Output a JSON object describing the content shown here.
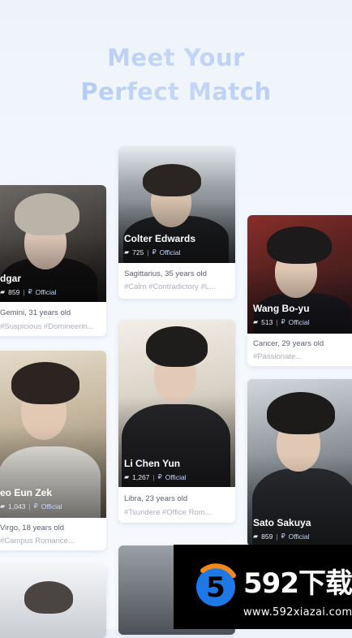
{
  "headline": {
    "line1": "Meet Your",
    "line2": "Perfect Match"
  },
  "characters": [
    {
      "name": "dgar",
      "chats": "859",
      "badge": "Official",
      "zodiac_age": "Gemini, 31 years old",
      "tags": "#Suspicious #Domineerin..."
    },
    {
      "name": "Colter Edwards",
      "chats": "725",
      "badge": "Official",
      "zodiac_age": "Sagittarius, 35 years old",
      "tags": "#Calm #Contradictory #L..."
    },
    {
      "name": "Wang Bo-yu",
      "chats": "513",
      "badge": "Official",
      "zodiac_age": "Cancer, 29 years old",
      "tags": "#Passionate..."
    },
    {
      "name": "eo Eun Zek",
      "chats": "1,043",
      "badge": "Official",
      "zodiac_age": "Virgo, 18 years old",
      "tags": "#Campus Romance..."
    },
    {
      "name": "Li Chen Yun",
      "chats": "1,267",
      "badge": "Official",
      "zodiac_age": "Libra, 23 years old",
      "tags": "#Tsundere #Office Rom..."
    },
    {
      "name": "Sato Sakuya",
      "chats": "859",
      "badge": "Official",
      "zodiac_age": "",
      "tags": ""
    }
  ],
  "icons": {
    "chat": "chat-bubble-icon",
    "official": "official-badge-icon"
  },
  "watermark": {
    "brand": "592下载",
    "url": "www.592xiazai.com",
    "mark_digit": "5",
    "colors": {
      "blue": "#1e78e6",
      "orange": "#f08a1e",
      "bg": "#000000"
    }
  }
}
